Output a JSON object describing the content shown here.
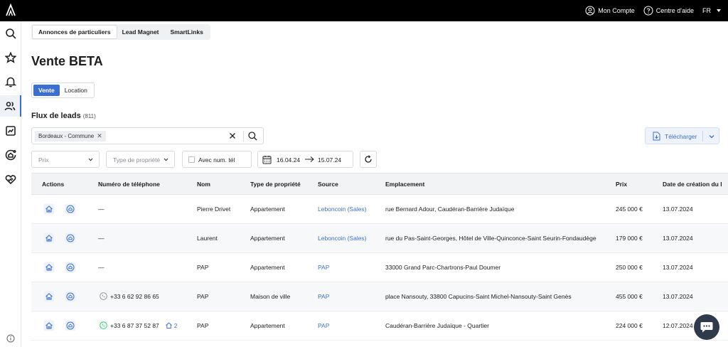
{
  "topbar": {
    "account_label": "Mon Compte",
    "help_label": "Centre d'aide",
    "lang_label": "FR"
  },
  "subtabs": [
    "Annonces de particuliers",
    "Lead Magnet",
    "SmartLinks"
  ],
  "page": {
    "title": "Vente BETA"
  },
  "segment": {
    "vente": "Vente",
    "location": "Location"
  },
  "flux": {
    "title": "Flux de leads",
    "count": "(811)"
  },
  "search": {
    "chip": "Bordeaux - Commune"
  },
  "download": {
    "label": "Télécharger"
  },
  "filters": {
    "prix": "Prix",
    "type": "Type de propriété",
    "tel": "Avec num. tél",
    "date_from": "16.04.24",
    "date_to": "15.07.24"
  },
  "table": {
    "headers": {
      "actions": "Actions",
      "phone": "Numéro de téléphone",
      "nom": "Nom",
      "type": "Type de propriété",
      "source": "Source",
      "emplacement": "Emplacement",
      "prix": "Prix",
      "date": "Date de création du l"
    },
    "rows": [
      {
        "phone": "—",
        "nom": "Pierre Drivet",
        "type": "Appartement",
        "source": "Leboncoin (Sales)",
        "emplacement": "rue Bernard Adour, Caudéran-Barrière Judaïque",
        "prix": "245 000 €",
        "date": "13.07.2024"
      },
      {
        "phone": "—",
        "nom": "Laurent",
        "type": "Appartement",
        "source": "Leboncoin (Sales)",
        "emplacement": "rue du Pas-Saint-Georges, Hôtel de Ville-Quinconce-Saint Seurin-Fondaudège",
        "prix": "179 000 €",
        "date": "13.07.2024"
      },
      {
        "phone": "—",
        "nom": "PAP",
        "type": "Appartement",
        "source": "PAP",
        "emplacement": "33000 Grand Parc-Chartrons-Paul Doumer",
        "prix": "250 000 €",
        "date": "13.07.2024"
      },
      {
        "phone": "+33 6 62 92 86 65",
        "nom": "PAP",
        "type": "Maison de ville",
        "source": "PAP",
        "emplacement": "place Nansouty, 33800 Capucins-Saint Michel-Nansouty-Saint Genès",
        "prix": "455 000 €",
        "date": "13.07.2024"
      },
      {
        "phone": "+33 6 87 37 52 87",
        "dup": "2",
        "nom": "PAP",
        "type": "Appartement",
        "source": "PAP",
        "emplacement": "Caudéran-Barrière Judaïque - Quartier",
        "prix": "224 000 €",
        "date": "12.07.2024"
      }
    ]
  },
  "colors": {
    "accent": "#3b6fd1",
    "topbar": "#000000",
    "whatsapp": "#25d366"
  }
}
